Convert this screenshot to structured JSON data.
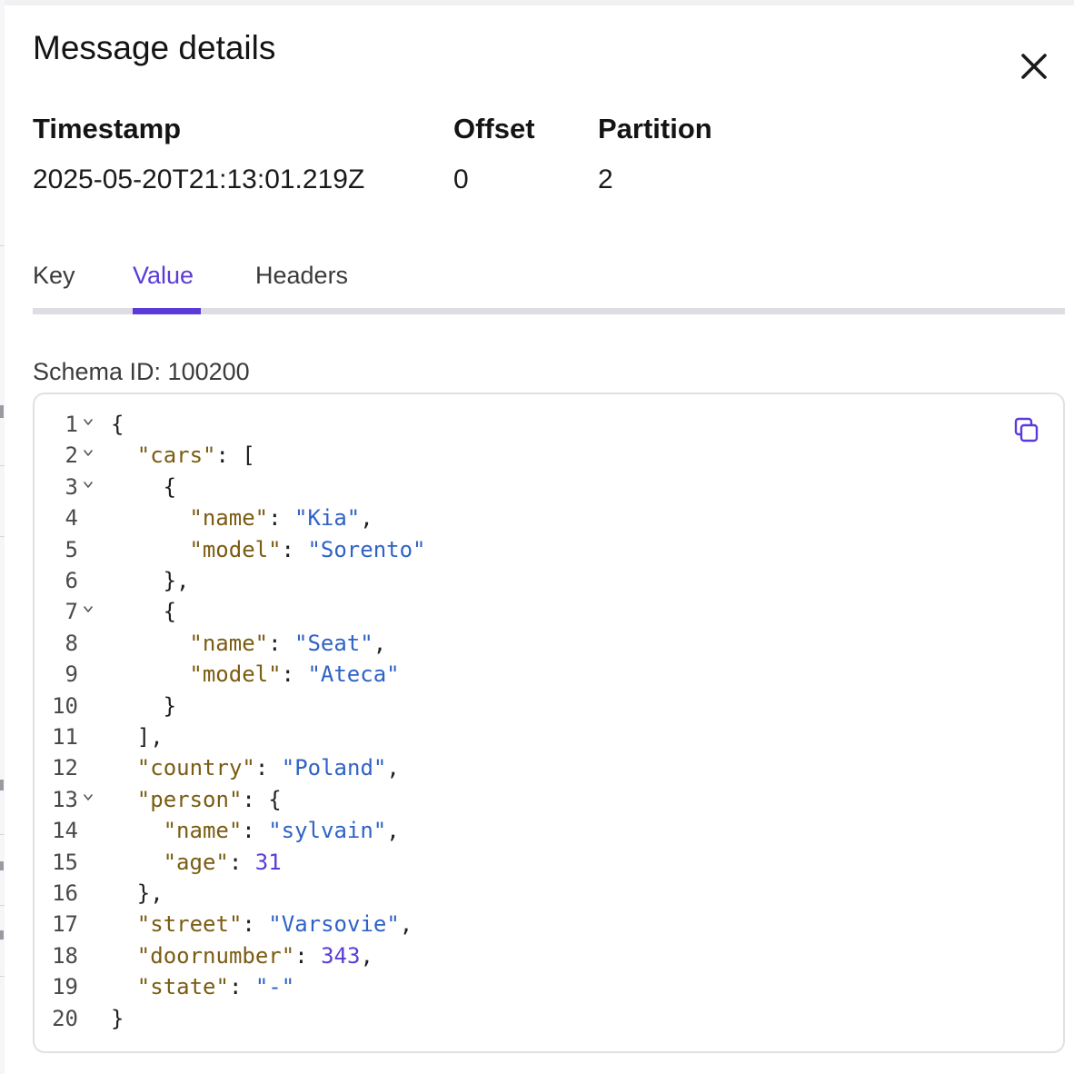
{
  "drawer": {
    "title": "Message details",
    "close_icon": "close-icon"
  },
  "meta": {
    "timestamp_label": "Timestamp",
    "timestamp_value": "2025-05-20T21:13:01.219Z",
    "offset_label": "Offset",
    "offset_value": "0",
    "partition_label": "Partition",
    "partition_value": "2"
  },
  "tabs": [
    {
      "label": "Key",
      "active": false
    },
    {
      "label": "Value",
      "active": true
    },
    {
      "label": "Headers",
      "active": false
    }
  ],
  "schema_id_text": "Schema ID: 100200",
  "code": {
    "copy_icon": "copy-icon",
    "fold_icon": "chevron-down-icon",
    "lines": [
      {
        "num": "1",
        "foldable": true,
        "indent": 0,
        "tokens": [
          {
            "t": "{",
            "k": "punct"
          }
        ]
      },
      {
        "num": "2",
        "foldable": true,
        "indent": 1,
        "tokens": [
          {
            "t": "\"cars\"",
            "k": "key"
          },
          {
            "t": ": [",
            "k": "punct"
          }
        ]
      },
      {
        "num": "3",
        "foldable": true,
        "indent": 2,
        "tokens": [
          {
            "t": "{",
            "k": "punct"
          }
        ]
      },
      {
        "num": "4",
        "foldable": false,
        "indent": 3,
        "tokens": [
          {
            "t": "\"name\"",
            "k": "key"
          },
          {
            "t": ": ",
            "k": "punct"
          },
          {
            "t": "\"Kia\"",
            "k": "str"
          },
          {
            "t": ",",
            "k": "punct"
          }
        ]
      },
      {
        "num": "5",
        "foldable": false,
        "indent": 3,
        "tokens": [
          {
            "t": "\"model\"",
            "k": "key"
          },
          {
            "t": ": ",
            "k": "punct"
          },
          {
            "t": "\"Sorento\"",
            "k": "str"
          }
        ]
      },
      {
        "num": "6",
        "foldable": false,
        "indent": 2,
        "tokens": [
          {
            "t": "},",
            "k": "punct"
          }
        ]
      },
      {
        "num": "7",
        "foldable": true,
        "indent": 2,
        "tokens": [
          {
            "t": "{",
            "k": "punct"
          }
        ]
      },
      {
        "num": "8",
        "foldable": false,
        "indent": 3,
        "tokens": [
          {
            "t": "\"name\"",
            "k": "key"
          },
          {
            "t": ": ",
            "k": "punct"
          },
          {
            "t": "\"Seat\"",
            "k": "str"
          },
          {
            "t": ",",
            "k": "punct"
          }
        ]
      },
      {
        "num": "9",
        "foldable": false,
        "indent": 3,
        "tokens": [
          {
            "t": "\"model\"",
            "k": "key"
          },
          {
            "t": ": ",
            "k": "punct"
          },
          {
            "t": "\"Ateca\"",
            "k": "str"
          }
        ]
      },
      {
        "num": "10",
        "foldable": false,
        "indent": 2,
        "tokens": [
          {
            "t": "}",
            "k": "punct"
          }
        ]
      },
      {
        "num": "11",
        "foldable": false,
        "indent": 1,
        "tokens": [
          {
            "t": "],",
            "k": "punct"
          }
        ]
      },
      {
        "num": "12",
        "foldable": false,
        "indent": 1,
        "tokens": [
          {
            "t": "\"country\"",
            "k": "key"
          },
          {
            "t": ": ",
            "k": "punct"
          },
          {
            "t": "\"Poland\"",
            "k": "str"
          },
          {
            "t": ",",
            "k": "punct"
          }
        ]
      },
      {
        "num": "13",
        "foldable": true,
        "indent": 1,
        "tokens": [
          {
            "t": "\"person\"",
            "k": "key"
          },
          {
            "t": ": {",
            "k": "punct"
          }
        ]
      },
      {
        "num": "14",
        "foldable": false,
        "indent": 2,
        "tokens": [
          {
            "t": "\"name\"",
            "k": "key"
          },
          {
            "t": ": ",
            "k": "punct"
          },
          {
            "t": "\"sylvain\"",
            "k": "str"
          },
          {
            "t": ",",
            "k": "punct"
          }
        ]
      },
      {
        "num": "15",
        "foldable": false,
        "indent": 2,
        "tokens": [
          {
            "t": "\"age\"",
            "k": "key"
          },
          {
            "t": ": ",
            "k": "punct"
          },
          {
            "t": "31",
            "k": "num"
          }
        ]
      },
      {
        "num": "16",
        "foldable": false,
        "indent": 1,
        "tokens": [
          {
            "t": "},",
            "k": "punct"
          }
        ]
      },
      {
        "num": "17",
        "foldable": false,
        "indent": 1,
        "tokens": [
          {
            "t": "\"street\"",
            "k": "key"
          },
          {
            "t": ": ",
            "k": "punct"
          },
          {
            "t": "\"Varsovie\"",
            "k": "str"
          },
          {
            "t": ",",
            "k": "punct"
          }
        ]
      },
      {
        "num": "18",
        "foldable": false,
        "indent": 1,
        "tokens": [
          {
            "t": "\"doornumber\"",
            "k": "key"
          },
          {
            "t": ": ",
            "k": "punct"
          },
          {
            "t": "343",
            "k": "num"
          },
          {
            "t": ",",
            "k": "punct"
          }
        ]
      },
      {
        "num": "19",
        "foldable": false,
        "indent": 1,
        "tokens": [
          {
            "t": "\"state\"",
            "k": "key"
          },
          {
            "t": ": ",
            "k": "punct"
          },
          {
            "t": "\"-\"",
            "k": "str"
          }
        ]
      },
      {
        "num": "20",
        "foldable": false,
        "indent": 0,
        "tokens": [
          {
            "t": "}",
            "k": "punct"
          }
        ]
      }
    ]
  },
  "colors": {
    "accent": "#5b3bd8",
    "json_key": "#7a5c12",
    "json_string": "#2f62c6",
    "json_number": "#5b3bd8"
  }
}
